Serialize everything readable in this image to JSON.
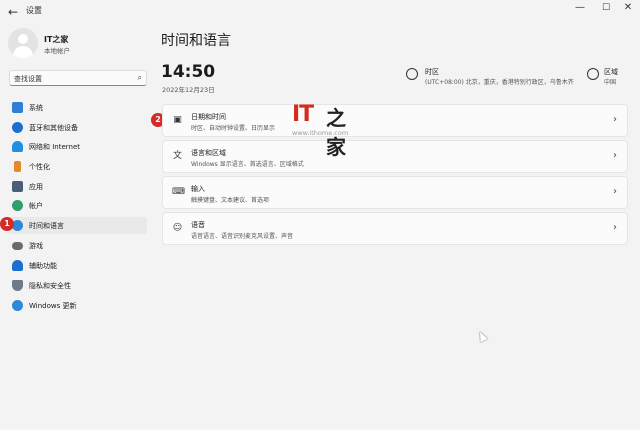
{
  "window": {
    "back_glyph": "←",
    "title": "设置",
    "minimize_glyph": "—",
    "maximize_glyph": "☐",
    "close_glyph": "✕"
  },
  "profile": {
    "name": "IT之家",
    "account_type": "本地帐户"
  },
  "search": {
    "placeholder": "查找设置",
    "icon": "search-icon"
  },
  "nav": {
    "items": [
      {
        "label": "系统",
        "icon": "monitor-icon",
        "color": "#2f7fd6"
      },
      {
        "label": "蓝牙和其他设备",
        "icon": "bluetooth-icon",
        "color": "#1a6fd1"
      },
      {
        "label": "网络和 Internet",
        "icon": "wifi-icon",
        "color": "#1f8fe0"
      },
      {
        "label": "个性化",
        "icon": "brush-icon",
        "color": "#e08a2a"
      },
      {
        "label": "应用",
        "icon": "apps-icon",
        "color": "#4a5d7a"
      },
      {
        "label": "帐户",
        "icon": "account-icon",
        "color": "#2e9e6a"
      },
      {
        "label": "时间和语言",
        "icon": "globe-clock-icon",
        "color": "#2c88d8"
      },
      {
        "label": "游戏",
        "icon": "gamepad-icon",
        "color": "#6b6b6b"
      },
      {
        "label": "辅助功能",
        "icon": "accessibility-icon",
        "color": "#1a6fd1"
      },
      {
        "label": "隐私和安全性",
        "icon": "shield-icon",
        "color": "#6c7a8a"
      },
      {
        "label": "Windows 更新",
        "icon": "update-icon",
        "color": "#2c88d8"
      }
    ],
    "active_index": 6
  },
  "badges": {
    "first": "1",
    "second": "2",
    "color": "#d32b26"
  },
  "main": {
    "title": "时间和语言",
    "time": "14:50",
    "date": "2022年12月23日",
    "timezone": {
      "label": "时区",
      "value": "(UTC+08:00) 北京，重庆，香港特别行政区，乌鲁木齐"
    },
    "region": {
      "label": "区域",
      "value": "中国"
    }
  },
  "cards": [
    {
      "title": "日期和时间",
      "subtitle": "时区、自动时钟设置、日历显示",
      "icon": "calendar-clock-icon"
    },
    {
      "title": "语言和区域",
      "subtitle": "Windows 显示语言、首选语言、区域格式",
      "icon": "language-icon"
    },
    {
      "title": "输入",
      "subtitle": "触摸键盘、文本建议、首选项",
      "icon": "keyboard-icon"
    },
    {
      "title": "语音",
      "subtitle": "语音语言、语音识别麦克风设置、声音",
      "icon": "speech-icon"
    }
  ],
  "watermark": {
    "logo": "IT",
    "mark": "之家",
    "url": "www.ithome.com"
  },
  "accent_color": "#0067c0"
}
